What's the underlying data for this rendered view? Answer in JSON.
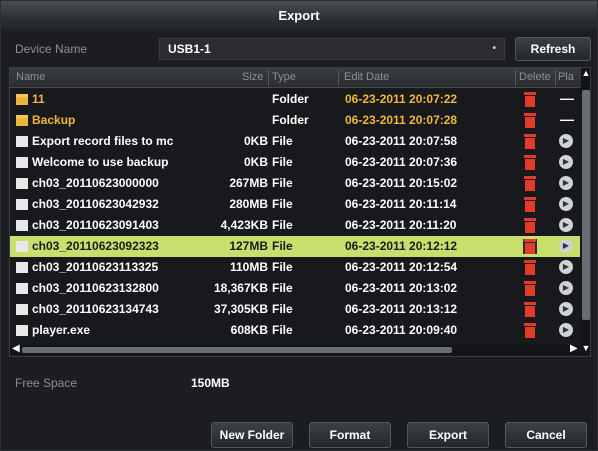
{
  "dialog": {
    "title": "Export"
  },
  "device": {
    "label": "Device Name",
    "selected": "USB1-1",
    "refresh_label": "Refresh"
  },
  "table": {
    "headers": {
      "name": "Name",
      "size": "Size",
      "type": "Type",
      "date": "Edit Date",
      "delete": "Delete",
      "play": "Pla"
    },
    "rows": [
      {
        "name": "11",
        "size": "",
        "type": "Folder",
        "date": "06-23-2011 20:07:22",
        "kind": "folder"
      },
      {
        "name": "Backup",
        "size": "",
        "type": "Folder",
        "date": "06-23-2011 20:07:28",
        "kind": "folder"
      },
      {
        "name": "Export record files to mc",
        "size": "0KB",
        "type": "File",
        "date": "06-23-2011 20:07:58",
        "kind": "file"
      },
      {
        "name": "Welcome to use backup",
        "size": "0KB",
        "type": "File",
        "date": "06-23-2011 20:07:36",
        "kind": "file"
      },
      {
        "name": "ch03_20110623000000",
        "size": "267MB",
        "type": "File",
        "date": "06-23-2011 20:15:02",
        "kind": "file"
      },
      {
        "name": "ch03_20110623042932",
        "size": "280MB",
        "type": "File",
        "date": "06-23-2011 20:11:14",
        "kind": "file"
      },
      {
        "name": "ch03_20110623091403",
        "size": "4,423KB",
        "type": "File",
        "date": "06-23-2011 20:11:20",
        "kind": "file"
      },
      {
        "name": "ch03_20110623092323",
        "size": "127MB",
        "type": "File",
        "date": "06-23-2011 20:12:12",
        "kind": "file",
        "selected": true
      },
      {
        "name": "ch03_20110623113325",
        "size": "110MB",
        "type": "File",
        "date": "06-23-2011 20:12:54",
        "kind": "file"
      },
      {
        "name": "ch03_20110623132800",
        "size": "18,367KB",
        "type": "File",
        "date": "06-23-2011 20:13:02",
        "kind": "file"
      },
      {
        "name": "ch03_20110623134743",
        "size": "37,305KB",
        "type": "File",
        "date": "06-23-2011 20:13:12",
        "kind": "file"
      },
      {
        "name": "player.exe",
        "size": "608KB",
        "type": "File",
        "date": "06-23-2011 20:09:40",
        "kind": "file"
      }
    ]
  },
  "free_space": {
    "label": "Free Space",
    "value": "150MB"
  },
  "buttons": {
    "new_folder": "New Folder",
    "format": "Format",
    "export": "Export",
    "cancel": "Cancel"
  },
  "colors": {
    "selected_row": "#c8df6e",
    "folder_text": "#f3b63b",
    "delete_icon": "#e23b2a"
  }
}
